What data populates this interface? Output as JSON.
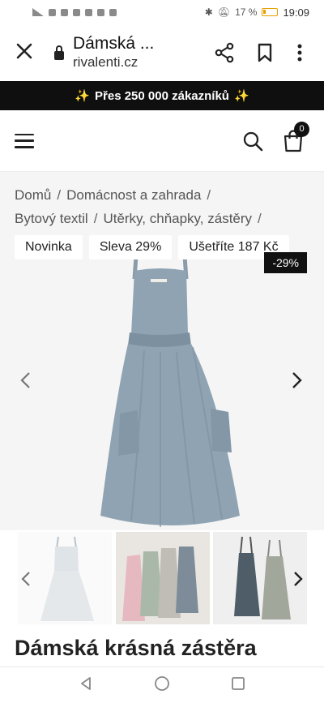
{
  "status_bar": {
    "battery": "17 %",
    "time": "19:09"
  },
  "browser": {
    "title": "Dámská ...",
    "url": "rivalenti.cz"
  },
  "promo": {
    "text": "Přes 250 000 zákazníků",
    "sparkle": "✨"
  },
  "header": {
    "cart_count": "0"
  },
  "breadcrumb": {
    "items": [
      "Domů",
      "Domácnost a zahrada",
      "Bytový textil",
      "Utěrky, chňapky, zástěry"
    ],
    "separator": "/"
  },
  "badges": {
    "new": "Novinka",
    "sale": "Sleva 29%",
    "save": "Ušetříte 187 Kč"
  },
  "discount_tag": "-29%",
  "product": {
    "title": "Dámská krásná zástěra"
  },
  "colors": {
    "apron_blue": "#8fa3b3",
    "apron_blue_dark": "#7c90a0",
    "promo_bg": "#0f0f0f"
  }
}
